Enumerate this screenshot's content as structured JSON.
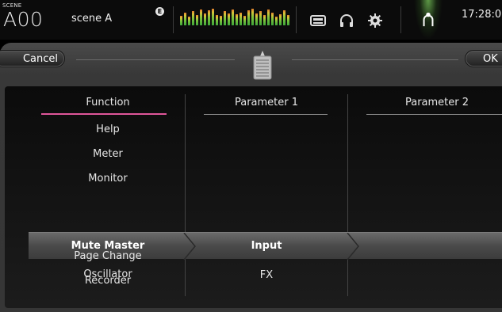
{
  "top_bar": {
    "scene_label": "SCENE",
    "scene_number": "A00",
    "scene_name": "scene A",
    "edit_badge": "E",
    "clock": "17:28:0",
    "icons": [
      "recorder-icon",
      "headphones-icon",
      "setup-gear-icon",
      "user-icon"
    ],
    "meter_levels": [
      0.55,
      0.75,
      0.5,
      0.8,
      0.6,
      0.9,
      0.7,
      0.85,
      0.95,
      0.6,
      0.55,
      0.8,
      0.7,
      0.9,
      0.65,
      0.75,
      0.55,
      0.85,
      0.95,
      0.7,
      0.8,
      0.6,
      0.9,
      0.75,
      0.5,
      0.65,
      0.85,
      0.6
    ]
  },
  "dialog": {
    "cancel_label": "Cancel",
    "ok_label": "OK",
    "columns": {
      "function_header": "Function",
      "parameter1_header": "Parameter 1",
      "parameter2_header": "Parameter 2"
    },
    "functions": [
      "Help",
      "Meter",
      "Monitor",
      "Mute Master",
      "Oscillator",
      "Page Change",
      "Recorder"
    ],
    "selected_function": "Mute Master",
    "parameter1": [
      "Input",
      "FX"
    ],
    "selected_parameter1": "Input"
  },
  "colors": {
    "function_underline": "#e0569a",
    "selection_bar": "#555555"
  }
}
